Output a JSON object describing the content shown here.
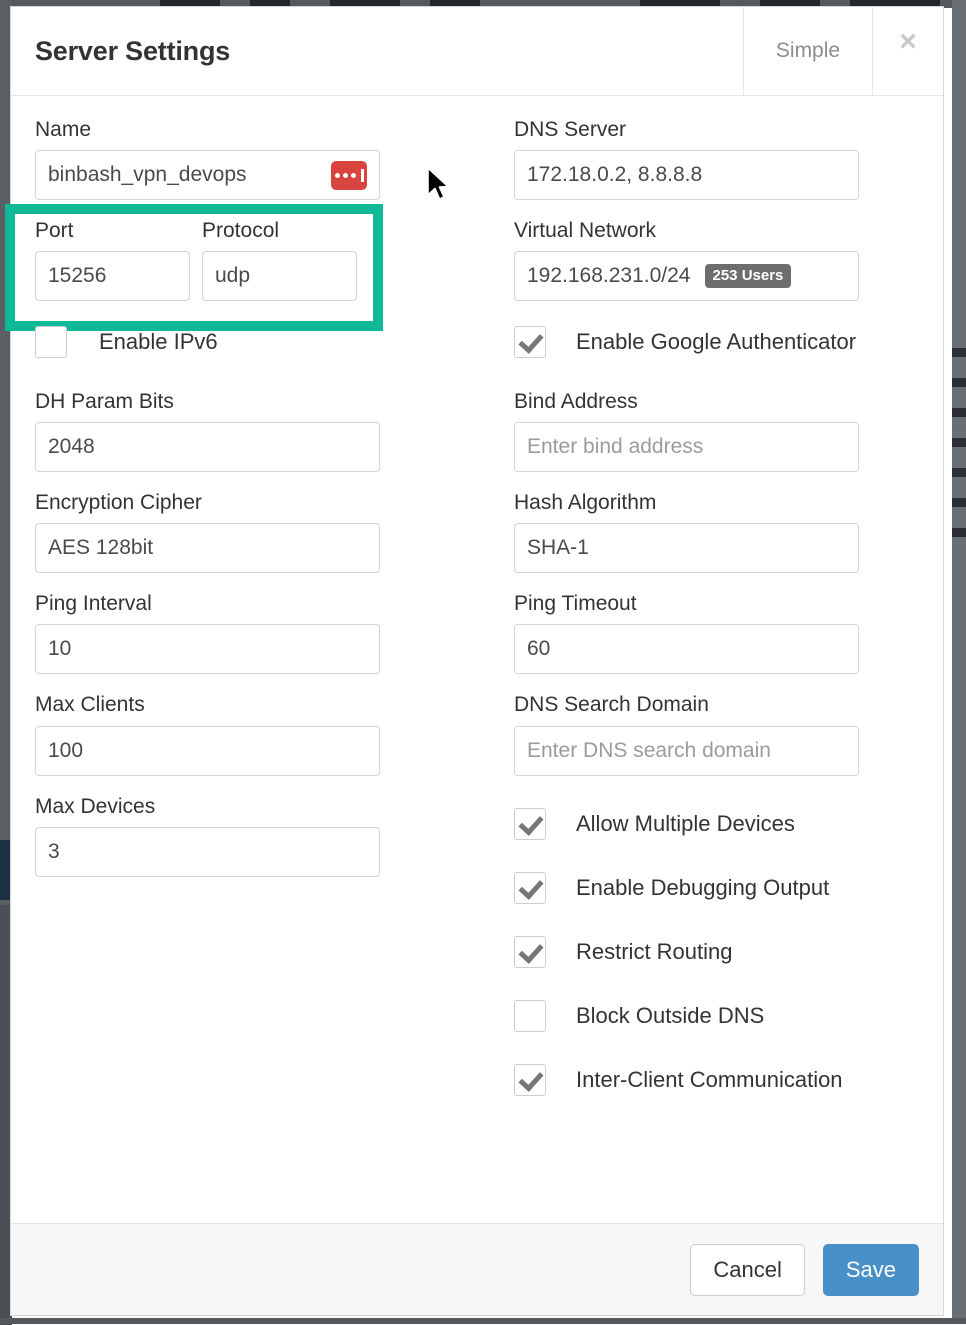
{
  "window": {
    "title": "Server Settings",
    "mode_tab": "Simple",
    "close_icon": "close-icon"
  },
  "colors": {
    "highlight": "#0fb897",
    "primary_button": "#4a90c8",
    "console_badge": "#d9443f",
    "users_badge": "#6d6d6d"
  },
  "left_column": {
    "name": {
      "label": "Name",
      "value": "binbash_vpn_devops",
      "badge_icon": "console-dots-icon"
    },
    "port": {
      "label": "Port",
      "value": "15256"
    },
    "protocol": {
      "label": "Protocol",
      "value": "udp"
    },
    "enable_ipv6": {
      "label": "Enable IPv6",
      "checked": false
    },
    "dh_param_bits": {
      "label": "DH Param Bits",
      "value": "2048"
    },
    "encryption_cipher": {
      "label": "Encryption Cipher",
      "value": "AES 128bit"
    },
    "ping_interval": {
      "label": "Ping Interval",
      "value": "10"
    },
    "max_clients": {
      "label": "Max Clients",
      "value": "100"
    },
    "max_devices": {
      "label": "Max Devices",
      "value": "3"
    }
  },
  "right_column": {
    "dns_server": {
      "label": "DNS Server",
      "value": "172.18.0.2, 8.8.8.8"
    },
    "virtual_network": {
      "label": "Virtual Network",
      "value": "192.168.231.0/24",
      "badge": "253 Users"
    },
    "enable_google_authenticator": {
      "label": "Enable Google Authenticator",
      "checked": true
    },
    "bind_address": {
      "label": "Bind Address",
      "value": "",
      "placeholder": "Enter bind address"
    },
    "hash_algorithm": {
      "label": "Hash Algorithm",
      "value": "SHA-1"
    },
    "ping_timeout": {
      "label": "Ping Timeout",
      "value": "60"
    },
    "dns_search_domain": {
      "label": "DNS Search Domain",
      "value": "",
      "placeholder": "Enter DNS search domain"
    },
    "checkboxes": [
      {
        "label": "Allow Multiple Devices",
        "checked": true
      },
      {
        "label": "Enable Debugging Output",
        "checked": true
      },
      {
        "label": "Restrict Routing",
        "checked": true
      },
      {
        "label": "Block Outside DNS",
        "checked": false
      },
      {
        "label": "Inter-Client Communication",
        "checked": true
      }
    ]
  },
  "footer": {
    "cancel_label": "Cancel",
    "save_label": "Save"
  }
}
